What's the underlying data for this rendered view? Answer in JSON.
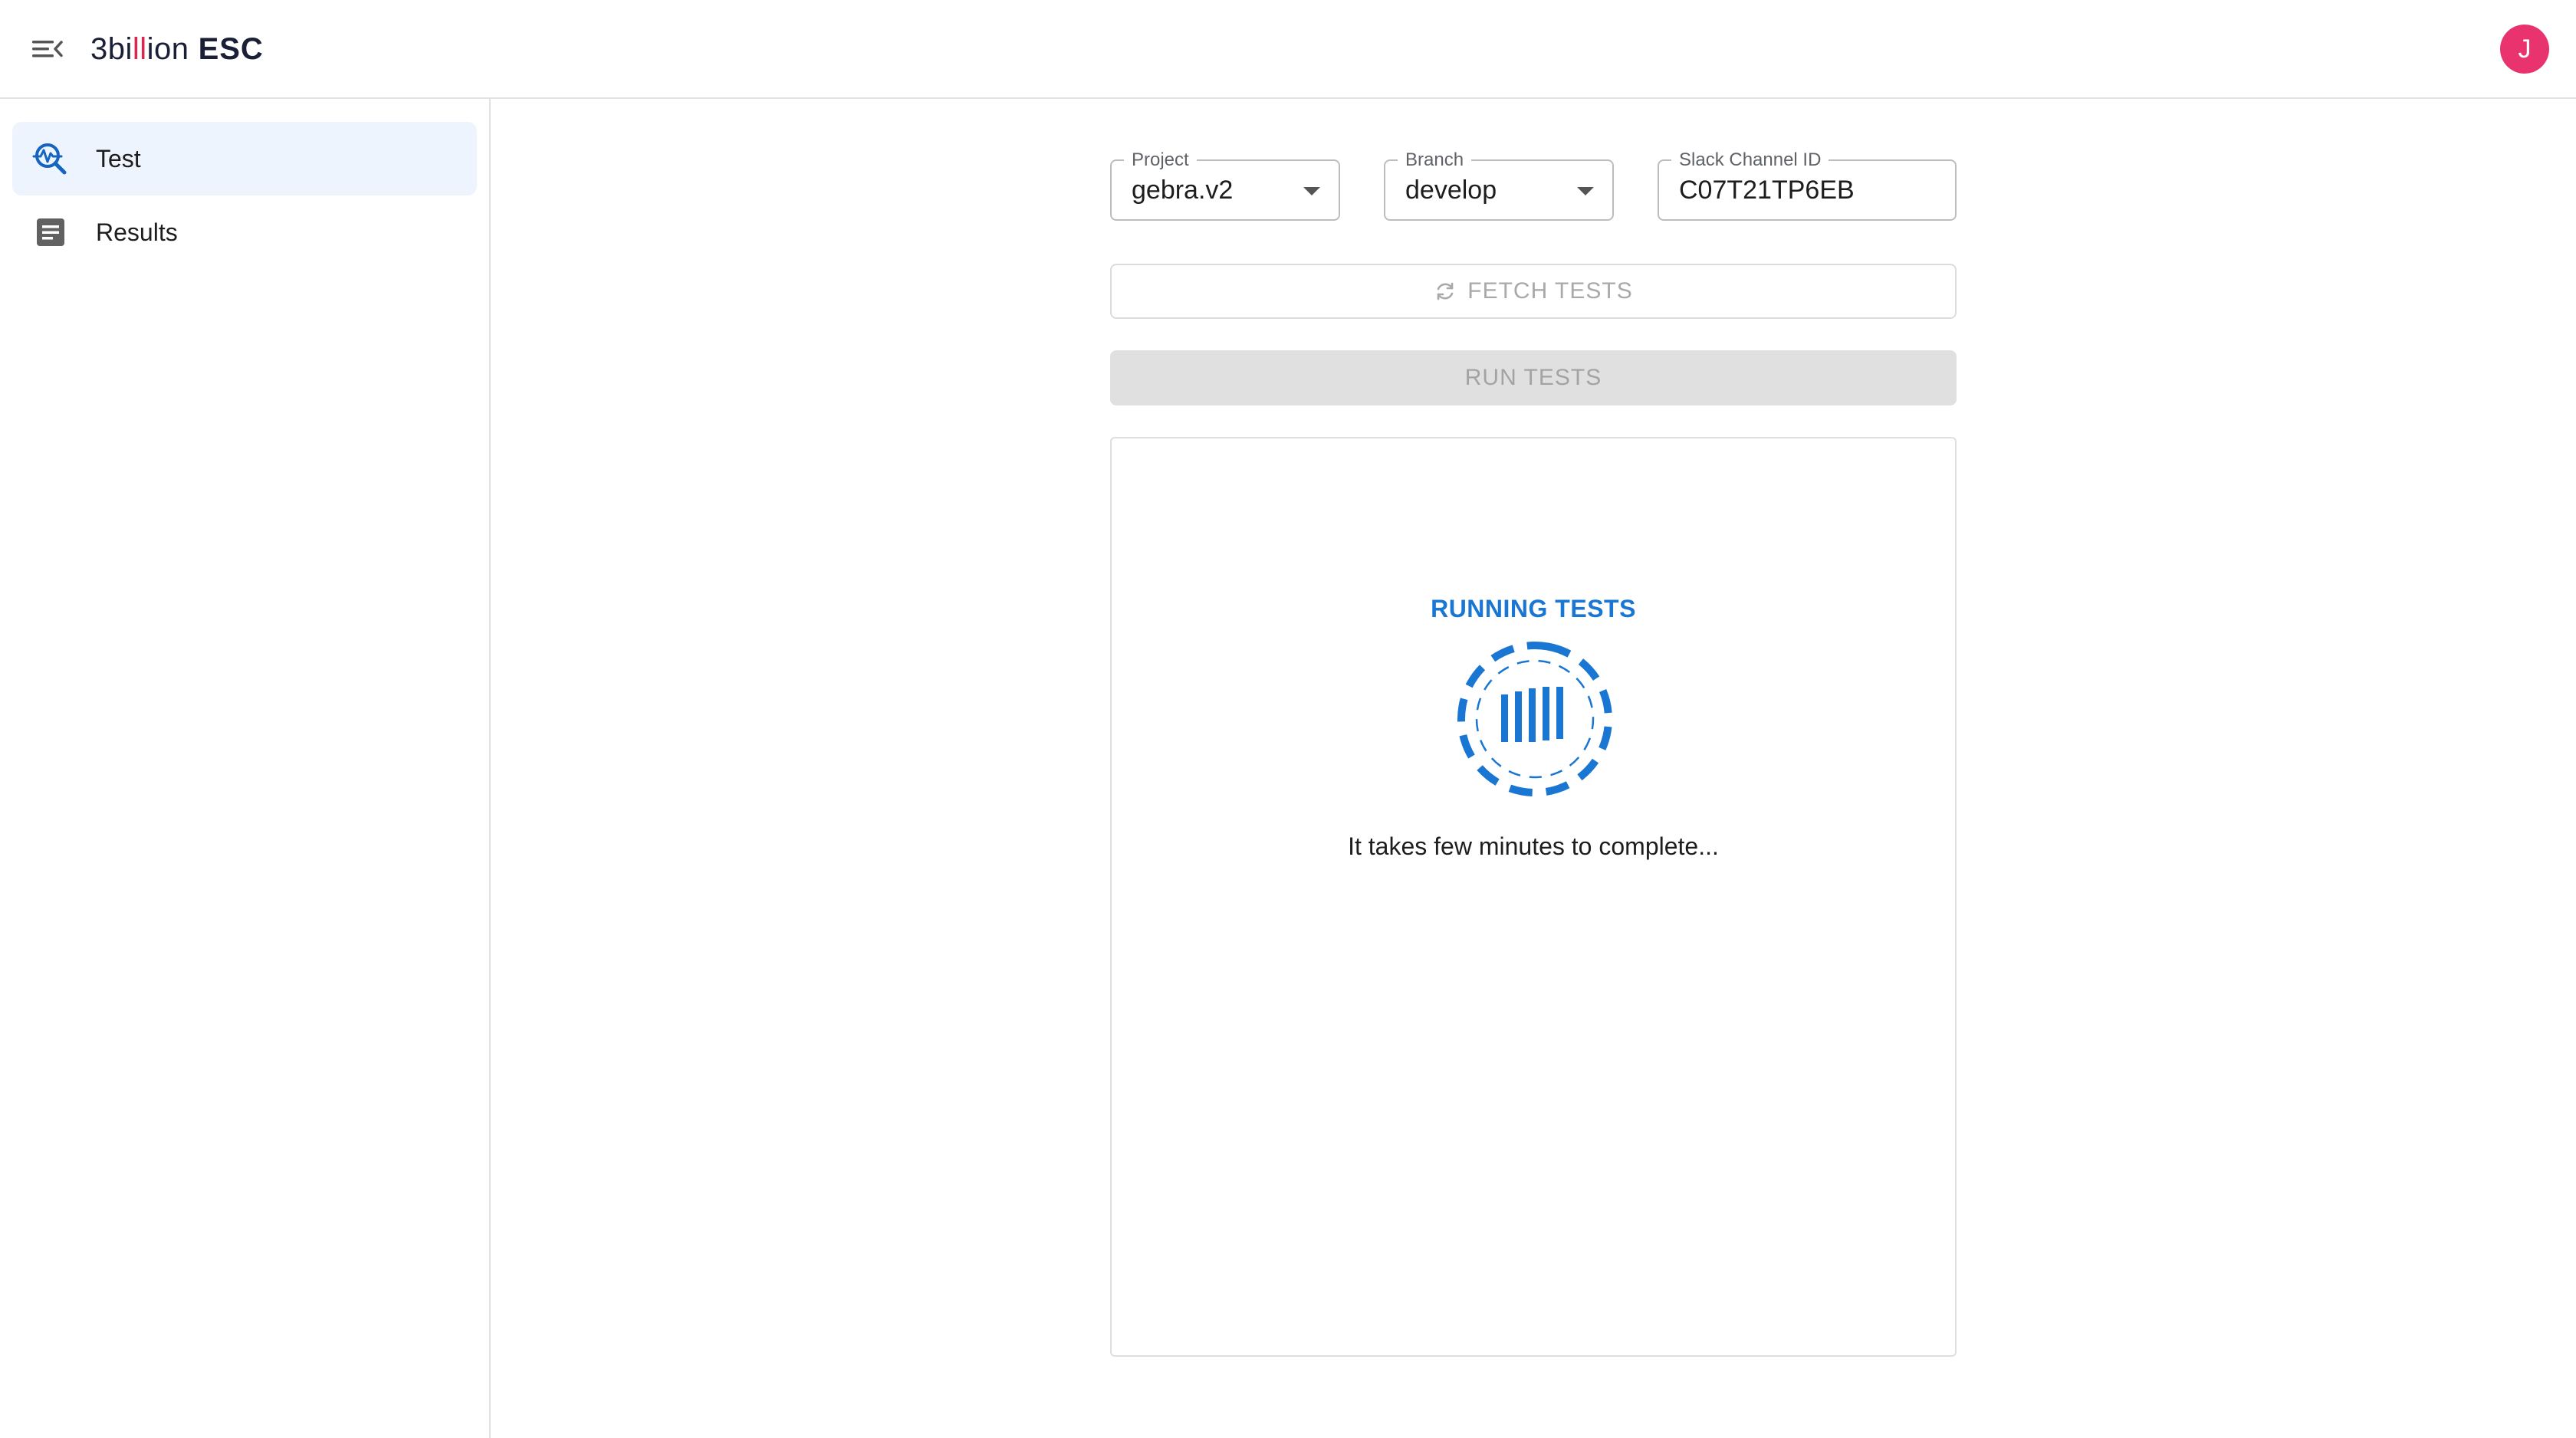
{
  "app": {
    "logo_prefix": "3bi",
    "logo_accent": "ll",
    "logo_suffix": "ion",
    "logo_product": "ESC",
    "user_initial": "J"
  },
  "sidebar": {
    "items": [
      {
        "label": "Test",
        "icon": "search-activity-icon",
        "active": true
      },
      {
        "label": "Results",
        "icon": "document-icon",
        "active": false
      }
    ]
  },
  "form": {
    "project": {
      "label": "Project",
      "value": "gebra.v2"
    },
    "branch": {
      "label": "Branch",
      "value": "develop"
    },
    "slack": {
      "label": "Slack Channel ID",
      "value": "C07T21TP6EB"
    }
  },
  "actions": {
    "fetch_label": "FETCH TESTS",
    "run_label": "RUN TESTS"
  },
  "status": {
    "title": "RUNNING TESTS",
    "message": "It takes few minutes to complete..."
  },
  "colors": {
    "primary": "#1976d2",
    "avatar": "#e8336f",
    "accent": "#e0244f",
    "active_nav": "#edf4fd"
  }
}
